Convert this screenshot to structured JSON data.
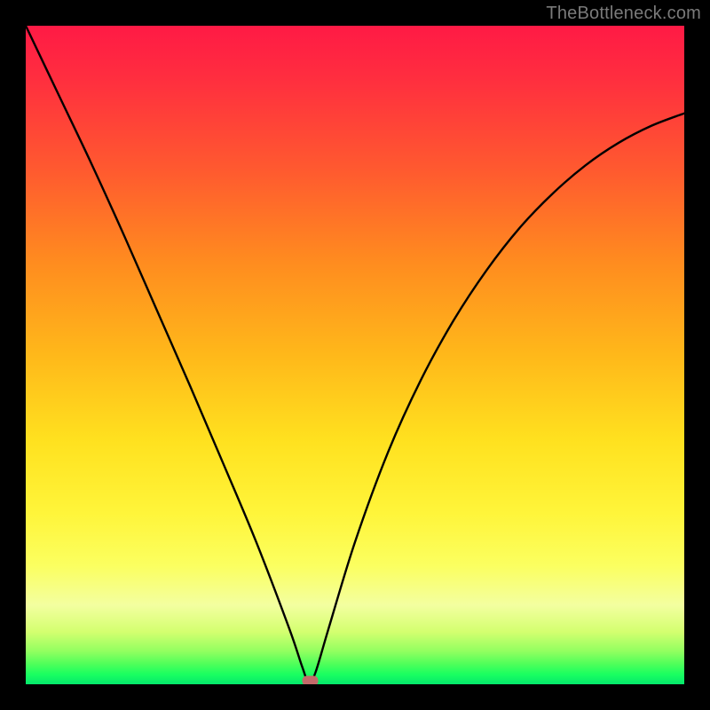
{
  "watermark": "TheBottleneck.com",
  "chart_data": {
    "type": "line",
    "title": "",
    "xlabel": "",
    "ylabel": "",
    "xlim": [
      0,
      1
    ],
    "ylim": [
      0,
      1
    ],
    "legend": false,
    "grid": false,
    "note": "Axes are unlabeled and unticked in the source image; values are normalized 0–1. Curve reaches ~0 at x≈0.43 and rises on both sides.",
    "series": [
      {
        "name": "curve",
        "x": [
          0.0,
          0.05,
          0.1,
          0.15,
          0.2,
          0.25,
          0.3,
          0.35,
          0.4,
          0.42,
          0.43,
          0.44,
          0.46,
          0.5,
          0.55,
          0.6,
          0.65,
          0.7,
          0.75,
          0.8,
          0.85,
          0.9,
          0.95,
          1.0
        ],
        "values": [
          1.0,
          0.895,
          0.79,
          0.68,
          0.566,
          0.452,
          0.335,
          0.216,
          0.085,
          0.026,
          0.002,
          0.018,
          0.085,
          0.216,
          0.352,
          0.462,
          0.553,
          0.629,
          0.693,
          0.745,
          0.788,
          0.822,
          0.848,
          0.867
        ]
      }
    ],
    "marker": {
      "x": 0.432,
      "y": 0.006,
      "color": "#c46a6a",
      "shape": "rounded-rect"
    },
    "background_gradient": {
      "direction": "vertical",
      "stops": [
        {
          "pos": 0.0,
          "color": "#ff1a45"
        },
        {
          "pos": 0.22,
          "color": "#ff5a2f"
        },
        {
          "pos": 0.5,
          "color": "#ffb81a"
        },
        {
          "pos": 0.74,
          "color": "#fff53a"
        },
        {
          "pos": 0.92,
          "color": "#d4ff70"
        },
        {
          "pos": 1.0,
          "color": "#04e86b"
        }
      ]
    }
  }
}
